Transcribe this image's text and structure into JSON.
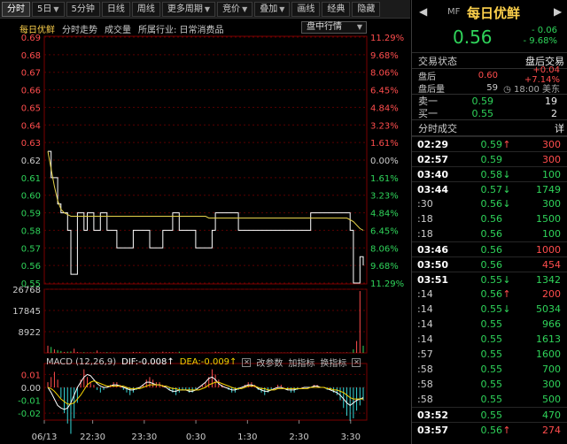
{
  "toolbar": {
    "items": [
      {
        "label": "分时",
        "active": true,
        "caret": false
      },
      {
        "label": "5日",
        "active": false,
        "caret": true
      },
      {
        "label": "5分钟",
        "active": false,
        "caret": false
      },
      {
        "label": "日线",
        "active": false,
        "caret": false
      },
      {
        "label": "周线",
        "active": false,
        "caret": false
      },
      {
        "label": "更多周期",
        "active": false,
        "caret": true
      },
      {
        "label": "竞价",
        "active": false,
        "caret": true
      },
      {
        "label": "叠加",
        "active": false,
        "caret": true
      },
      {
        "label": "画线",
        "active": false,
        "caret": false
      },
      {
        "label": "经典",
        "active": false,
        "caret": false
      },
      {
        "label": "隐藏",
        "active": false,
        "caret": false
      }
    ]
  },
  "chart_header": {
    "stock_name": "每日优鲜",
    "labels": [
      "分时走势",
      "成交量",
      "所属行业: 日常消费品"
    ],
    "market_select": "盘中行情"
  },
  "macd_header": {
    "name": "MACD (12,26,9)",
    "dif": "DIF:-0.008↑",
    "dea": "DEA:-0.009↑",
    "buttons": [
      "改参数",
      "加指标",
      "换指标"
    ]
  },
  "side": {
    "code": "MF",
    "name": "每日优鲜",
    "price": "0.56",
    "change": "- 0.06",
    "change_pct": "- 9.68%",
    "status_title": "交易状态",
    "status_value": "盘后交易",
    "after_hours": [
      {
        "label": "盘后",
        "v1": "0.60",
        "v2": "+0.04 +7.14%"
      },
      {
        "label": "盘后量",
        "v1": "59",
        "v2": "18:00 美东"
      }
    ],
    "orderbook": [
      {
        "label": "卖一",
        "price": "0.59",
        "qty": "19"
      },
      {
        "label": "买一",
        "price": "0.55",
        "qty": "2"
      }
    ],
    "ticks_title": "分时成交",
    "ticks_detail": "详",
    "ticks": [
      {
        "time": "02:29",
        "bold": true,
        "price": "0.59",
        "dir": "up",
        "vol": "300"
      },
      {
        "time": "02:57",
        "bold": true,
        "price": "0.59",
        "dir": "",
        "vol": "300"
      },
      {
        "time": "03:40",
        "bold": true,
        "price": "0.58",
        "dir": "down",
        "vol": "100"
      },
      {
        "time": "03:44",
        "bold": true,
        "price": "0.57",
        "dir": "down",
        "vol": "1749"
      },
      {
        "time": ":30",
        "bold": false,
        "price": "0.56",
        "dir": "down",
        "vol": "300"
      },
      {
        "time": ":18",
        "bold": false,
        "price": "0.56",
        "dir": "",
        "vol": "1500"
      },
      {
        "time": ":18",
        "bold": false,
        "price": "0.56",
        "dir": "",
        "vol": "100"
      },
      {
        "time": "03:46",
        "bold": true,
        "price": "0.56",
        "dir": "",
        "vol": "1000"
      },
      {
        "time": "03:50",
        "bold": true,
        "price": "0.56",
        "dir": "",
        "vol": "454"
      },
      {
        "time": "03:51",
        "bold": true,
        "price": "0.55",
        "dir": "down",
        "vol": "1342"
      },
      {
        "time": ":14",
        "bold": false,
        "price": "0.56",
        "dir": "up",
        "vol": "200"
      },
      {
        "time": ":14",
        "bold": false,
        "price": "0.55",
        "dir": "down",
        "vol": "5034"
      },
      {
        "time": ":14",
        "bold": false,
        "price": "0.55",
        "dir": "",
        "vol": "966"
      },
      {
        "time": ":14",
        "bold": false,
        "price": "0.55",
        "dir": "",
        "vol": "1613"
      },
      {
        "time": ":57",
        "bold": false,
        "price": "0.55",
        "dir": "",
        "vol": "1600"
      },
      {
        "time": ":58",
        "bold": false,
        "price": "0.55",
        "dir": "",
        "vol": "700"
      },
      {
        "time": ":58",
        "bold": false,
        "price": "0.55",
        "dir": "",
        "vol": "300"
      },
      {
        "time": ":58",
        "bold": false,
        "price": "0.55",
        "dir": "",
        "vol": "500"
      },
      {
        "time": "03:52",
        "bold": true,
        "price": "0.55",
        "dir": "",
        "vol": "470"
      },
      {
        "time": "03:57",
        "bold": true,
        "price": "0.56",
        "dir": "up",
        "vol": "274"
      }
    ]
  },
  "colors": {
    "up": "#ff4d4d",
    "down": "#2fd45a",
    "avg_line": "#e6d24a",
    "price_line": "#ffffff",
    "grid": "#8b0000"
  },
  "chart_data": [
    {
      "type": "line",
      "title": "",
      "price_ticks": [
        "0.69",
        "0.68",
        "0.67",
        "0.66",
        "0.65",
        "0.64",
        "0.63",
        "0.62",
        "0.61",
        "0.60",
        "0.59",
        "0.58",
        "0.57",
        "0.56",
        "0.55"
      ],
      "pct_ticks": [
        "11.29%",
        "9.68%",
        "8.06%",
        "6.45%",
        "4.84%",
        "3.23%",
        "1.61%",
        "0.00%",
        "1.61%",
        "3.23%",
        "4.84%",
        "6.45%",
        "8.06%",
        "9.68%",
        "11.29%"
      ],
      "ylim": [
        0.55,
        0.69
      ],
      "prev_close": 0.62,
      "x_ticks": [
        "06/13",
        "22:30",
        "23:30",
        "0:30",
        "1:30",
        "2:30",
        "3:30"
      ],
      "series": [
        {
          "values": [
            0.625,
            0.61,
            0.61,
            0.595,
            0.59,
            0.59,
            0.58,
            0.555,
            0.555,
            0.59,
            0.59,
            0.58,
            0.59,
            0.59,
            0.58,
            0.58,
            0.59,
            0.59,
            0.58,
            0.58,
            0.58,
            0.57,
            0.57,
            0.57,
            0.57,
            0.57,
            0.58,
            0.58,
            0.58,
            0.58,
            0.58,
            0.57,
            0.57,
            0.57,
            0.57,
            0.58,
            0.58,
            0.58,
            0.59,
            0.59,
            0.58,
            0.58,
            0.58,
            0.58,
            0.58,
            0.57,
            0.57,
            0.57,
            0.57,
            0.57,
            0.58,
            0.59,
            0.59,
            0.59,
            0.59,
            0.59,
            0.59,
            0.59,
            0.58,
            0.58,
            0.58,
            0.58,
            0.58,
            0.58,
            0.58,
            0.58,
            0.58,
            0.58,
            0.58,
            0.58,
            0.58,
            0.58,
            0.58,
            0.58,
            0.58,
            0.58,
            0.58,
            0.58,
            0.58,
            0.58,
            0.59,
            0.59,
            0.59,
            0.59,
            0.59,
            0.59,
            0.59,
            0.59,
            0.59,
            0.59,
            0.59,
            0.59,
            0.58,
            0.55,
            0.55,
            0.565,
            0.56
          ]
        },
        {
          "values": [
            0.625,
            0.615,
            0.605,
            0.597,
            0.592,
            0.59,
            0.589,
            0.588,
            0.588,
            0.588,
            0.588,
            0.588,
            0.588,
            0.588,
            0.588,
            0.588,
            0.588,
            0.588,
            0.588,
            0.588,
            0.588,
            0.588,
            0.588,
            0.588,
            0.588,
            0.588,
            0.588,
            0.588,
            0.588,
            0.588,
            0.588,
            0.588,
            0.588,
            0.588,
            0.588,
            0.588,
            0.588,
            0.588,
            0.588,
            0.588,
            0.588,
            0.588,
            0.588,
            0.588,
            0.588,
            0.588,
            0.588,
            0.588,
            0.588,
            0.587,
            0.587,
            0.587,
            0.587,
            0.587,
            0.587,
            0.587,
            0.587,
            0.587,
            0.587,
            0.587,
            0.587,
            0.587,
            0.587,
            0.587,
            0.587,
            0.587,
            0.587,
            0.587,
            0.587,
            0.587,
            0.587,
            0.587,
            0.587,
            0.587,
            0.587,
            0.587,
            0.587,
            0.587,
            0.587,
            0.587,
            0.587,
            0.587,
            0.587,
            0.587,
            0.587,
            0.587,
            0.587,
            0.587,
            0.587,
            0.587,
            0.587,
            0.587,
            0.586,
            0.585,
            0.583,
            0.581,
            0.58
          ]
        }
      ]
    },
    {
      "type": "bar",
      "title": "",
      "y_ticks": [
        "26768",
        "17845",
        "8922"
      ],
      "ylim": [
        0,
        26768
      ],
      "values": [
        3000,
        2500,
        1500,
        1200,
        800,
        400,
        500,
        600,
        1800,
        400,
        200,
        300,
        150,
        200,
        200,
        1000,
        200,
        200,
        300,
        200,
        200,
        100,
        100,
        100,
        100,
        100,
        400,
        300,
        400,
        100,
        100,
        200,
        200,
        200,
        100,
        500,
        300,
        300,
        300,
        200,
        500,
        100,
        100,
        100,
        100,
        100,
        200,
        100,
        100,
        100,
        100,
        500,
        300,
        200,
        300,
        100,
        300,
        300,
        300,
        100,
        100,
        100,
        100,
        100,
        100,
        100,
        100,
        100,
        100,
        100,
        100,
        100,
        100,
        100,
        300,
        100,
        100,
        100,
        100,
        100,
        100,
        200,
        100,
        100,
        100,
        300,
        300,
        100,
        100,
        100,
        100,
        200,
        100,
        1500,
        5000,
        26000,
        3000
      ]
    },
    {
      "type": "bar",
      "title": "",
      "y_ticks": [
        "0.01",
        "0.00",
        "-0.01",
        "-0.02"
      ],
      "ylim": [
        -0.024,
        0.013
      ],
      "histogram": [
        0.002,
        0.004,
        0.006,
        0.003,
        -0.004,
        -0.01,
        -0.014,
        -0.018,
        -0.012,
        -0.006,
        0.003,
        0.007,
        0.004,
        0.002,
        0.001,
        -0.001,
        -0.002,
        -0.001,
        0.0,
        0.001,
        0.002,
        0.002,
        0.001,
        -0.001,
        -0.002,
        -0.003,
        -0.002,
        -0.001,
        0.0,
        0.001,
        0.003,
        0.004,
        0.003,
        0.002,
        0.002,
        0.001,
        0.0,
        -0.001,
        -0.002,
        -0.003,
        -0.002,
        -0.001,
        -0.001,
        -0.002,
        -0.002,
        -0.001,
        0.0,
        0.001,
        0.002,
        0.004,
        0.007,
        0.005,
        0.003,
        0.001,
        0.0,
        -0.001,
        -0.002,
        -0.002,
        -0.001,
        0.0,
        0.001,
        0.002,
        0.002,
        0.001,
        -0.001,
        -0.002,
        -0.003,
        -0.002,
        -0.001,
        0.0,
        0.001,
        0.001,
        0.0,
        -0.001,
        -0.002,
        -0.002,
        -0.001,
        0.0,
        0.0,
        0.0,
        0.0,
        0.001,
        0.001,
        0.0,
        0.0,
        -0.001,
        -0.001,
        -0.002,
        -0.003,
        -0.005,
        -0.008,
        -0.011,
        -0.013,
        -0.012,
        -0.009,
        -0.007,
        -0.005
      ],
      "dif": [
        0.0,
        -0.004,
        -0.009,
        -0.014,
        -0.016,
        -0.017,
        -0.016,
        -0.012,
        -0.006,
        0.0,
        0.004,
        0.008,
        0.01,
        0.009,
        0.006,
        0.003,
        0.001,
        0.0,
        0.0,
        0.001,
        0.002,
        0.002,
        0.001,
        0.0,
        -0.001,
        -0.002,
        -0.002,
        -0.001,
        0.0,
        0.002,
        0.004,
        0.004,
        0.003,
        0.002,
        0.002,
        0.001,
        0.0,
        -0.002,
        -0.003,
        -0.003,
        -0.002,
        -0.002,
        -0.002,
        -0.003,
        -0.003,
        -0.002,
        0.0,
        0.002,
        0.004,
        0.007,
        0.008,
        0.006,
        0.003,
        0.001,
        0.0,
        -0.001,
        -0.002,
        -0.002,
        -0.001,
        0.0,
        0.001,
        0.002,
        0.002,
        0.001,
        -0.001,
        -0.002,
        -0.003,
        -0.003,
        -0.002,
        -0.001,
        0.0,
        0.0,
        -0.001,
        -0.002,
        -0.002,
        -0.002,
        -0.001,
        -0.001,
        0.0,
        0.0,
        0.0,
        0.001,
        0.001,
        0.0,
        0.0,
        -0.001,
        -0.002,
        -0.003,
        -0.004,
        -0.006,
        -0.009,
        -0.012,
        -0.014,
        -0.012,
        -0.01,
        -0.009,
        -0.008
      ],
      "dea": [
        0.0,
        -0.001,
        -0.003,
        -0.006,
        -0.009,
        -0.011,
        -0.013,
        -0.013,
        -0.012,
        -0.009,
        -0.006,
        -0.002,
        0.002,
        0.004,
        0.005,
        0.004,
        0.003,
        0.002,
        0.001,
        0.001,
        0.001,
        0.001,
        0.001,
        0.001,
        0.0,
        -0.001,
        -0.001,
        -0.001,
        -0.001,
        0.0,
        0.001,
        0.002,
        0.002,
        0.002,
        0.002,
        0.001,
        0.001,
        0.0,
        -0.001,
        -0.001,
        -0.002,
        -0.002,
        -0.002,
        -0.002,
        -0.002,
        -0.002,
        -0.002,
        -0.001,
        0.0,
        0.002,
        0.003,
        0.004,
        0.004,
        0.003,
        0.002,
        0.001,
        0.0,
        -0.001,
        -0.001,
        -0.001,
        0.0,
        0.001,
        0.001,
        0.001,
        0.0,
        -0.001,
        -0.001,
        -0.002,
        -0.002,
        -0.002,
        -0.001,
        -0.001,
        -0.001,
        -0.001,
        -0.001,
        -0.001,
        -0.001,
        -0.001,
        -0.001,
        -0.001,
        0.0,
        0.0,
        0.0,
        0.0,
        0.0,
        -0.001,
        -0.001,
        -0.002,
        -0.002,
        -0.003,
        -0.004,
        -0.006,
        -0.008,
        -0.009,
        -0.009,
        -0.009,
        -0.009
      ]
    }
  ]
}
